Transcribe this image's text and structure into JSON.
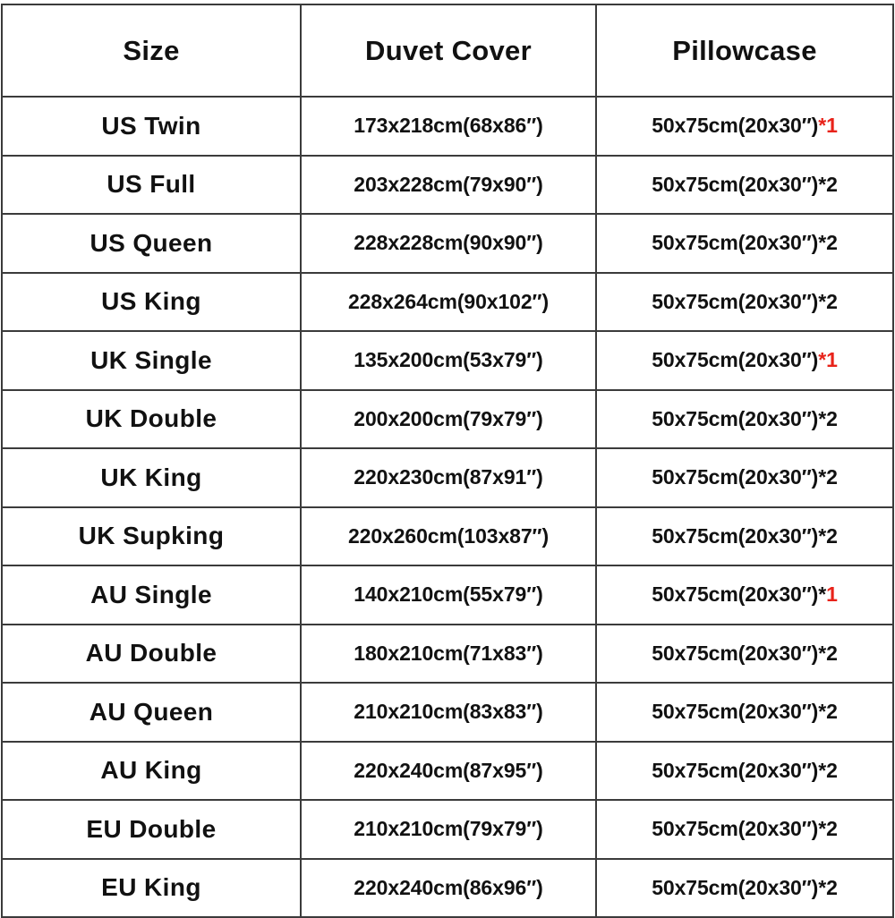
{
  "table": {
    "headers": {
      "size": "Size",
      "duvet": "Duvet Cover",
      "pillowcase": "Pillowcase"
    },
    "colors": {
      "border": "#3b3b3b",
      "text": "#111111",
      "highlight_red": "#e8231a",
      "background": "#ffffff"
    },
    "rows": [
      {
        "size": "US Twin",
        "duvet": "173x218cm(68x86″)",
        "pillow_base": "50x75cm(20x30″)",
        "pillow_mark": "*",
        "pillow_qty": "1",
        "mark_color": "red",
        "qty_color": "red"
      },
      {
        "size": "US Full",
        "duvet": "203x228cm(79x90″)",
        "pillow_base": "50x75cm(20x30″)",
        "pillow_mark": "*",
        "pillow_qty": "2",
        "mark_color": "black",
        "qty_color": "black"
      },
      {
        "size": "US Queen",
        "duvet": "228x228cm(90x90″)",
        "pillow_base": "50x75cm(20x30″)",
        "pillow_mark": "*",
        "pillow_qty": "2",
        "mark_color": "black",
        "qty_color": "black"
      },
      {
        "size": "US King",
        "duvet": "228x264cm(90x102″)",
        "pillow_base": "50x75cm(20x30″)",
        "pillow_mark": "*",
        "pillow_qty": "2",
        "mark_color": "black",
        "qty_color": "black"
      },
      {
        "size": "UK Single",
        "duvet": "135x200cm(53x79″)",
        "pillow_base": "50x75cm(20x30″)",
        "pillow_mark": "*",
        "pillow_qty": "1",
        "mark_color": "red",
        "qty_color": "red"
      },
      {
        "size": "UK Double",
        "duvet": "200x200cm(79x79″)",
        "pillow_base": "50x75cm(20x30″)",
        "pillow_mark": "*",
        "pillow_qty": "2",
        "mark_color": "black",
        "qty_color": "black"
      },
      {
        "size": "UK King",
        "duvet": "220x230cm(87x91″)",
        "pillow_base": "50x75cm(20x30″)",
        "pillow_mark": "*",
        "pillow_qty": "2",
        "mark_color": "black",
        "qty_color": "black"
      },
      {
        "size": "UK Supking",
        "duvet": "220x260cm(103x87″)",
        "pillow_base": "50x75cm(20x30″)",
        "pillow_mark": "*",
        "pillow_qty": "2",
        "mark_color": "black",
        "qty_color": "black"
      },
      {
        "size": "AU Single",
        "duvet": "140x210cm(55x79″)",
        "pillow_base": "50x75cm(20x30″)",
        "pillow_mark": "*",
        "pillow_qty": "1",
        "mark_color": "black",
        "qty_color": "red"
      },
      {
        "size": "AU Double",
        "duvet": "180x210cm(71x83″)",
        "pillow_base": "50x75cm(20x30″)",
        "pillow_mark": "*",
        "pillow_qty": "2",
        "mark_color": "black",
        "qty_color": "black"
      },
      {
        "size": "AU Queen",
        "duvet": "210x210cm(83x83″)",
        "pillow_base": "50x75cm(20x30″)",
        "pillow_mark": "*",
        "pillow_qty": "2",
        "mark_color": "black",
        "qty_color": "black"
      },
      {
        "size": "AU King",
        "duvet": "220x240cm(87x95″)",
        "pillow_base": "50x75cm(20x30″)",
        "pillow_mark": "*",
        "pillow_qty": "2",
        "mark_color": "black",
        "qty_color": "black"
      },
      {
        "size": "EU Double",
        "duvet": "210x210cm(79x79″)",
        "pillow_base": "50x75cm(20x30″)",
        "pillow_mark": "*",
        "pillow_qty": "2",
        "mark_color": "black",
        "qty_color": "black"
      },
      {
        "size": "EU King",
        "duvet": "220x240cm(86x96″)",
        "pillow_base": "50x75cm(20x30″)",
        "pillow_mark": "*",
        "pillow_qty": "2",
        "mark_color": "black",
        "qty_color": "black"
      }
    ]
  }
}
